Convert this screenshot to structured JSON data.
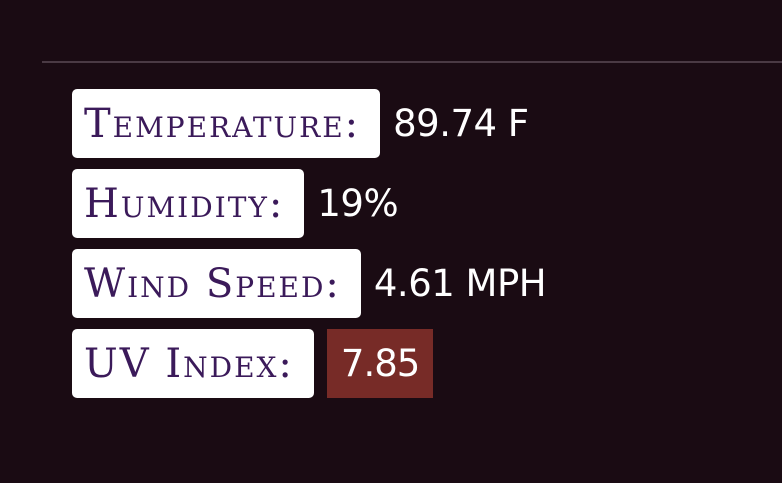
{
  "weather": {
    "temperature": {
      "label": "Temperature:",
      "value": "89.74 F"
    },
    "humidity": {
      "label": "Humidity:",
      "value": "19%"
    },
    "wind_speed": {
      "label": "Wind Speed:",
      "value": "4.61 MPH"
    },
    "uv_index": {
      "label": "UV Index:",
      "value": "7.85",
      "badge_color": "#772b27"
    }
  },
  "colors": {
    "background": "#1a0b13",
    "label_background": "#ffffff",
    "label_text": "#3b1a5a",
    "value_text": "#ffffff",
    "divider": "#4a3a44"
  }
}
